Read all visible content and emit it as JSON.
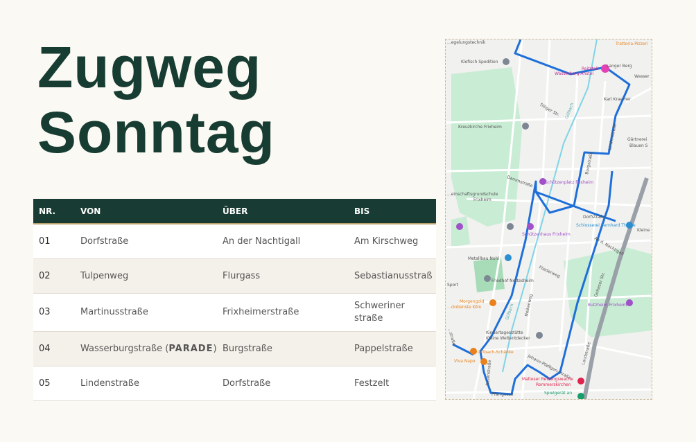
{
  "title": {
    "line1": "Zugweg",
    "line2": "Sonntag"
  },
  "table": {
    "headers": {
      "nr": "NR.",
      "von": "VON",
      "ueber": "ÜBER",
      "bis": "BIS"
    },
    "rows": [
      {
        "nr": "01",
        "von": "Dorfstraße",
        "ueber": "An der Nachtigall",
        "bis": "Am Kirschweg"
      },
      {
        "nr": "02",
        "von": "Tulpenweg",
        "ueber": "Flurgass",
        "bis": "Sebastianusstraß"
      },
      {
        "nr": "03",
        "von": "Martinusstraße",
        "ueber": "Frixheimerstraße",
        "bis": "Schweriner straße"
      },
      {
        "nr": "04",
        "von": "Wasserburgstraße",
        "von_extra": "PARADE",
        "ueber": "Burgstraße",
        "bis": "Pappelstraße"
      },
      {
        "nr": "05",
        "von": "Lindenstraße",
        "ueber": "Dorfstraße",
        "bis": "Festzelt"
      }
    ]
  },
  "map": {
    "route_color": "#1e6fd9",
    "labels": {
      "trattoria": "Trattoria-Pizzeri",
      "regelungstechnik": "...egelungstechnik",
      "spedition": "Klefisch Spedition",
      "reitstall": "Reitstall",
      "wasserburg_anstel": "Wasserburg Anstel",
      "langer_berg": "Langer Berg",
      "wasser": "Wasser",
      "tiliger_str": "Tilliger Str.",
      "karl_kraemer": "Karl Kraemer",
      "gillbach": "Gillbach",
      "kreuzkirche": "Kreuzkirche Frixheim",
      "lindenstrasse": "Lindenstraße",
      "gaertnerei": "Gärtnerei",
      "blauen": "Blauen S",
      "burgstrasse": "Burgstraße",
      "gemeinschaftsgrundschule": "...einschaftsgrundschule",
      "frixheim": "Frixheim",
      "dammstrasse": "Dammstraße",
      "schuetzenplatz": "Schützenplatz Frixheim",
      "dorfstrasse": "Dorfstraße",
      "schuetzenhaus": "Schützenhaus Frixheim",
      "schlosserei": "Schlosserei Bernhard Theine",
      "an_d_nachtigall": "An d. Nachtigall",
      "kleine": "Kleine",
      "metallbau": "Metallbau Nohl",
      "friedhof": "Friedhof Nettesheim",
      "flieder": "Fliederweg",
      "goltes": "Golteser Str.",
      "butzheim": "Butzheim-Frixheim",
      "morgengold": "Morgengold",
      "frischedienste": "...ckdienste Köln",
      "gillbach2": "Gillbach",
      "nelkenweg": "Nelkenweg",
      "kindertagesstaette": "Kindertagesstätte",
      "kleine_weltentdecker": "Kleine Weltentdecker",
      "gillbach_schaenke": "Gillbach-Schänke",
      "viva_napoli": "Viva Napo",
      "hallenstrasse": "Landstraße",
      "johann": "Johann-Pfaffgen-Straße",
      "malteser": "Malteser Rettungswache",
      "rommerskirchen": "Rommerskirchen",
      "pfarrgasse": "Pfarrgasse",
      "spielgeraet": "Spielgerät an",
      "roonstr": "Rosenstraße",
      "sport": "Sport",
      "hauptstr": "...straße"
    }
  }
}
